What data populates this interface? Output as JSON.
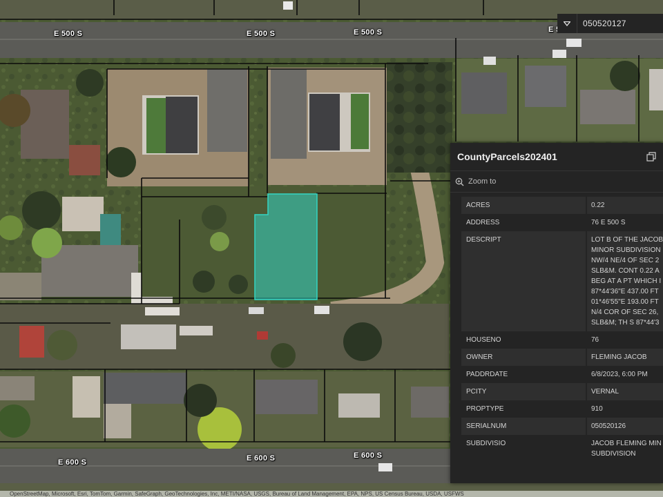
{
  "search": {
    "value": "050520127",
    "dropdown_icon": "triangle-down-icon"
  },
  "road_labels": [
    "E 500 S",
    "E 500 S",
    "E 500 S",
    "E 5",
    "E 600 S",
    "E 600 S",
    "E 600 S"
  ],
  "popup": {
    "title": "CountyParcels202401",
    "dock_icon": "dock-icon",
    "zoom_label": "Zoom to",
    "fields": [
      {
        "key": "ACRES",
        "value": "0.22"
      },
      {
        "key": "ADDRESS",
        "value": "76 E 500 S"
      },
      {
        "key": "DESCRIPT",
        "value": "LOT B OF THE JACOB\nMINOR SUBDIVISION\nNW/4 NE/4 OF SEC 2\nSLB&M. CONT 0.22 A\nBEG AT A PT WHICH I\n87*44'36\"E 437.00 FT\n01*46'55\"E 193.00 FT\nN/4 COR OF SEC 26,\nSLB&M; TH S 87*44'3"
      },
      {
        "key": "HOUSENO",
        "value": "76"
      },
      {
        "key": "OWNER",
        "value": "FLEMING JACOB"
      },
      {
        "key": "PADDRDATE",
        "value": "6/8/2023, 6:00 PM"
      },
      {
        "key": "PCITY",
        "value": "VERNAL"
      },
      {
        "key": "PROPTYPE",
        "value": "910"
      },
      {
        "key": "SERIALNUM",
        "value": "050520126"
      },
      {
        "key": "SUBDIVISIO",
        "value": "JACOB FLEMING MIN\nSUBDIVISION"
      }
    ]
  },
  "attribution": "OpenStreetMap, Microsoft, Esri, TomTom, Garmin, SafeGraph, GeoTechnologies, Inc, METI/NASA, USGS, Bureau of Land Management, EPA, NPS, US Census Bureau, USDA, USFWS",
  "colors": {
    "selection": "#33d6c4",
    "panel": "#242424",
    "parcel_line": "#0b0b0b"
  }
}
